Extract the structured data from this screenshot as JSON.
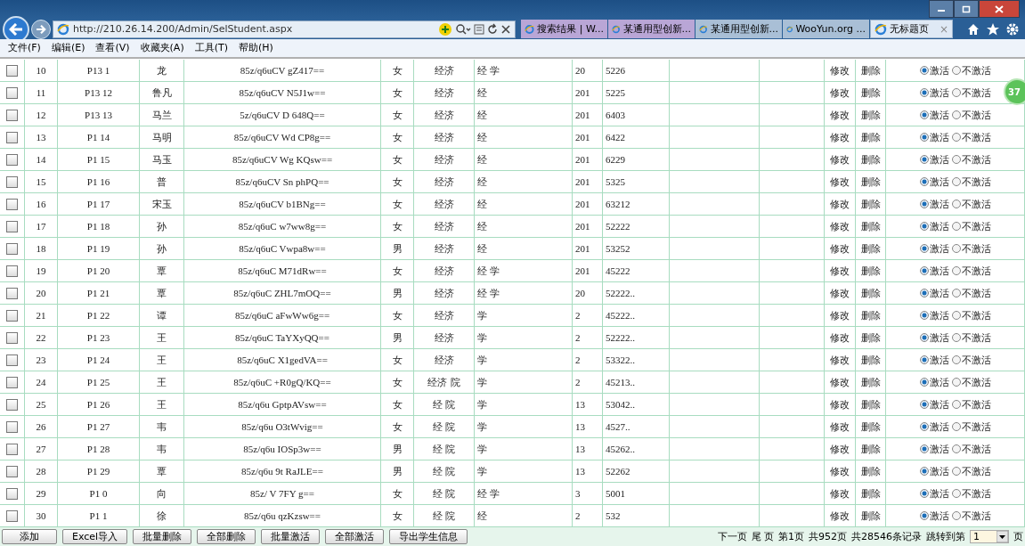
{
  "browser": {
    "address": "http://210.26.14.200/Admin/SelStudent.aspx",
    "tabs": [
      {
        "label": "搜索结果 | W...",
        "selected": false,
        "color": "#b9a6d6"
      },
      {
        "label": "某通用型创新...",
        "selected": false,
        "color": "#b9a6d6"
      },
      {
        "label": "某通用型创新...",
        "selected": false,
        "color": "#a9bfd6"
      },
      {
        "label": "WooYun.org ...",
        "selected": false,
        "color": "#a9bfd6"
      },
      {
        "label": "无标题页",
        "selected": true,
        "color": "#dfe9f5"
      }
    ],
    "close_tab": "×",
    "menu": [
      "文件(F)",
      "编辑(E)",
      "查看(V)",
      "收藏夹(A)",
      "工具(T)",
      "帮助(H)"
    ]
  },
  "rows": [
    {
      "checked": false,
      "no": "10",
      "id": "P13 1",
      "name": "龙",
      "hash": "85z/q6uCV gZ417==",
      "gender": "女",
      "college": "经济",
      "major": "经 学",
      "year": "20",
      "phone": "5226",
      "edit": "修改",
      "delete": "删除",
      "radios": [
        {
          "label": "激活",
          "selected": true
        },
        {
          "label": "不激活",
          "selected": false
        }
      ]
    },
    {
      "checked": false,
      "no": "11",
      "id": "P13 12",
      "name": "鲁凡",
      "hash": "85z/q6uCV N5J1w==",
      "gender": "女",
      "college": "经济",
      "major": "经",
      "year": "201",
      "phone": "5225",
      "edit": "修改",
      "delete": "删除",
      "radios": [
        {
          "label": "激活",
          "selected": true
        },
        {
          "label": "不激活",
          "selected": false
        }
      ]
    },
    {
      "checked": false,
      "no": "12",
      "id": "P13 13",
      "name": "马兰",
      "hash": "5z/q6uCV D 648Q==",
      "gender": "女",
      "college": "经济",
      "major": "经",
      "year": "201",
      "phone": "6403",
      "edit": "修改",
      "delete": "删除",
      "radios": [
        {
          "label": "激活",
          "selected": true
        },
        {
          "label": "不激活",
          "selected": false
        }
      ]
    },
    {
      "checked": false,
      "no": "13",
      "id": "P1 14",
      "name": "马明",
      "hash": "85z/q6uCV Wd CP8g==",
      "gender": "女",
      "college": "经济",
      "major": "经",
      "year": "201",
      "phone": "6422",
      "edit": "修改",
      "delete": "删除",
      "radios": [
        {
          "label": "激活",
          "selected": true
        },
        {
          "label": "不激活",
          "selected": false
        }
      ]
    },
    {
      "checked": false,
      "no": "14",
      "id": "P1 15",
      "name": "马玉",
      "hash": "85z/q6uCV Wg KQsw==",
      "gender": "女",
      "college": "经济",
      "major": "经",
      "year": "201",
      "phone": "6229",
      "edit": "修改",
      "delete": "删除",
      "radios": [
        {
          "label": "激活",
          "selected": true
        },
        {
          "label": "不激活",
          "selected": false
        }
      ]
    },
    {
      "checked": false,
      "no": "15",
      "id": "P1 16",
      "name": "普",
      "hash": "85z/q6uCV Sn phPQ==",
      "gender": "女",
      "college": "经济",
      "major": "经",
      "year": "201",
      "phone": "5325",
      "edit": "修改",
      "delete": "删除",
      "radios": [
        {
          "label": "激活",
          "selected": true
        },
        {
          "label": "不激活",
          "selected": false
        }
      ]
    },
    {
      "checked": false,
      "no": "16",
      "id": "P1 17",
      "name": "宋玉",
      "hash": "85z/q6uCV b1BNg==",
      "gender": "女",
      "college": "经济",
      "major": "经",
      "year": "201",
      "phone": "63212",
      "edit": "修改",
      "delete": "删除",
      "radios": [
        {
          "label": "激活",
          "selected": true
        },
        {
          "label": "不激活",
          "selected": false
        }
      ]
    },
    {
      "checked": false,
      "no": "17",
      "id": "P1 18",
      "name": "孙",
      "hash": "85z/q6uC w7ww8g==",
      "gender": "女",
      "college": "经济",
      "major": "经",
      "year": "201",
      "phone": "52222",
      "edit": "修改",
      "delete": "删除",
      "radios": [
        {
          "label": "激活",
          "selected": true
        },
        {
          "label": "不激活",
          "selected": false
        }
      ]
    },
    {
      "checked": false,
      "no": "18",
      "id": "P1 19",
      "name": "孙",
      "hash": "85z/q6uC Vwpa8w==",
      "gender": "男",
      "college": "经济",
      "major": "经",
      "year": "201",
      "phone": "53252",
      "edit": "修改",
      "delete": "删除",
      "radios": [
        {
          "label": "激活",
          "selected": true
        },
        {
          "label": "不激活",
          "selected": false
        }
      ]
    },
    {
      "checked": false,
      "no": "19",
      "id": "P1 20",
      "name": "覃",
      "hash": "85z/q6uC M71dRw==",
      "gender": "女",
      "college": "经济",
      "major": "经 学",
      "year": "201",
      "phone": "45222",
      "edit": "修改",
      "delete": "删除",
      "radios": [
        {
          "label": "激活",
          "selected": true
        },
        {
          "label": "不激活",
          "selected": false
        }
      ]
    },
    {
      "checked": false,
      "no": "20",
      "id": "P1 21",
      "name": "覃",
      "hash": "85z/q6uC ZHL7mOQ==",
      "gender": "男",
      "college": "经济",
      "major": "经 学",
      "year": "20",
      "phone": "52222..",
      "edit": "修改",
      "delete": "删除",
      "radios": [
        {
          "label": "激活",
          "selected": true
        },
        {
          "label": "不激活",
          "selected": false
        }
      ]
    },
    {
      "checked": false,
      "no": "21",
      "id": "P1 22",
      "name": "谭",
      "hash": "85z/q6uC aFwWw6g==",
      "gender": "女",
      "college": "经济",
      "major": "学",
      "year": "2",
      "phone": "45222..",
      "edit": "修改",
      "delete": "删除",
      "radios": [
        {
          "label": "激活",
          "selected": true
        },
        {
          "label": "不激活",
          "selected": false
        }
      ]
    },
    {
      "checked": false,
      "no": "22",
      "id": "P1 23",
      "name": "王",
      "hash": "85z/q6uC TaYXyQQ==",
      "gender": "男",
      "college": "经济",
      "major": "学",
      "year": "2",
      "phone": "52222..",
      "edit": "修改",
      "delete": "删除",
      "radios": [
        {
          "label": "激活",
          "selected": true
        },
        {
          "label": "不激活",
          "selected": false
        }
      ]
    },
    {
      "checked": false,
      "no": "23",
      "id": "P1 24",
      "name": "王",
      "hash": "85z/q6uC X1gedVA==",
      "gender": "女",
      "college": "经济",
      "major": "学",
      "year": "2",
      "phone": "53322..",
      "edit": "修改",
      "delete": "删除",
      "radios": [
        {
          "label": "激活",
          "selected": true
        },
        {
          "label": "不激活",
          "selected": false
        }
      ]
    },
    {
      "checked": false,
      "no": "24",
      "id": "P1 25",
      "name": "王",
      "hash": "85z/q6uC +R0gQ/KQ==",
      "gender": "女",
      "college": "经济 院",
      "major": "学",
      "year": "2",
      "phone": "45213..",
      "edit": "修改",
      "delete": "删除",
      "radios": [
        {
          "label": "激活",
          "selected": true
        },
        {
          "label": "不激活",
          "selected": false
        }
      ]
    },
    {
      "checked": false,
      "no": "25",
      "id": "P1 26",
      "name": "王",
      "hash": "85z/q6u GptpAVsw==",
      "gender": "女",
      "college": "经 院",
      "major": "学",
      "year": "13",
      "phone": "53042..",
      "edit": "修改",
      "delete": "删除",
      "radios": [
        {
          "label": "激活",
          "selected": true
        },
        {
          "label": "不激活",
          "selected": false
        }
      ]
    },
    {
      "checked": false,
      "no": "26",
      "id": "P1 27",
      "name": "韦",
      "hash": "85z/q6u O3tWvig==",
      "gender": "女",
      "college": "经 院",
      "major": "学",
      "year": "13",
      "phone": "4527..",
      "edit": "修改",
      "delete": "删除",
      "radios": [
        {
          "label": "激活",
          "selected": true
        },
        {
          "label": "不激活",
          "selected": false
        }
      ]
    },
    {
      "checked": false,
      "no": "27",
      "id": "P1 28",
      "name": "韦",
      "hash": "85z/q6u IOSp3w==",
      "gender": "男",
      "college": "经 院",
      "major": "学",
      "year": "13",
      "phone": "45262..",
      "edit": "修改",
      "delete": "删除",
      "radios": [
        {
          "label": "激活",
          "selected": true
        },
        {
          "label": "不激活",
          "selected": false
        }
      ]
    },
    {
      "checked": false,
      "no": "28",
      "id": "P1 29",
      "name": "覃",
      "hash": "85z/q6u 9t RaJLE==",
      "gender": "男",
      "college": "经 院",
      "major": "学",
      "year": "13",
      "phone": "52262",
      "edit": "修改",
      "delete": "删除",
      "radios": [
        {
          "label": "激活",
          "selected": true
        },
        {
          "label": "不激活",
          "selected": false
        }
      ]
    },
    {
      "checked": false,
      "no": "29",
      "id": "P1 0",
      "name": "向",
      "hash": "85z/ V 7FY g==",
      "gender": "女",
      "college": "经 院",
      "major": "经 学",
      "year": "3",
      "phone": "5001",
      "edit": "修改",
      "delete": "删除",
      "radios": [
        {
          "label": "激活",
          "selected": true
        },
        {
          "label": "不激活",
          "selected": false
        }
      ]
    },
    {
      "checked": false,
      "no": "30",
      "id": "P1 1",
      "name": "徐",
      "hash": "85z/q6u qzKzsw==",
      "gender": "女",
      "college": "经 院",
      "major": "经",
      "year": "2",
      "phone": "532",
      "edit": "修改",
      "delete": "删除",
      "radios": [
        {
          "label": "激活",
          "selected": true
        },
        {
          "label": "不激活",
          "selected": false
        }
      ]
    }
  ],
  "badge": "37",
  "buttons": [
    "添加",
    "Excel导入",
    "批量删除",
    "全部删除",
    "批量激活",
    "全部激活",
    "导出学生信息"
  ],
  "pager": {
    "next": "下一页",
    "last": "尾 页",
    "current": "第1页",
    "pages": "共952页",
    "records": "共28546条记录",
    "jump_label": "跳转到第",
    "jump_value": "1",
    "unit": "页"
  }
}
